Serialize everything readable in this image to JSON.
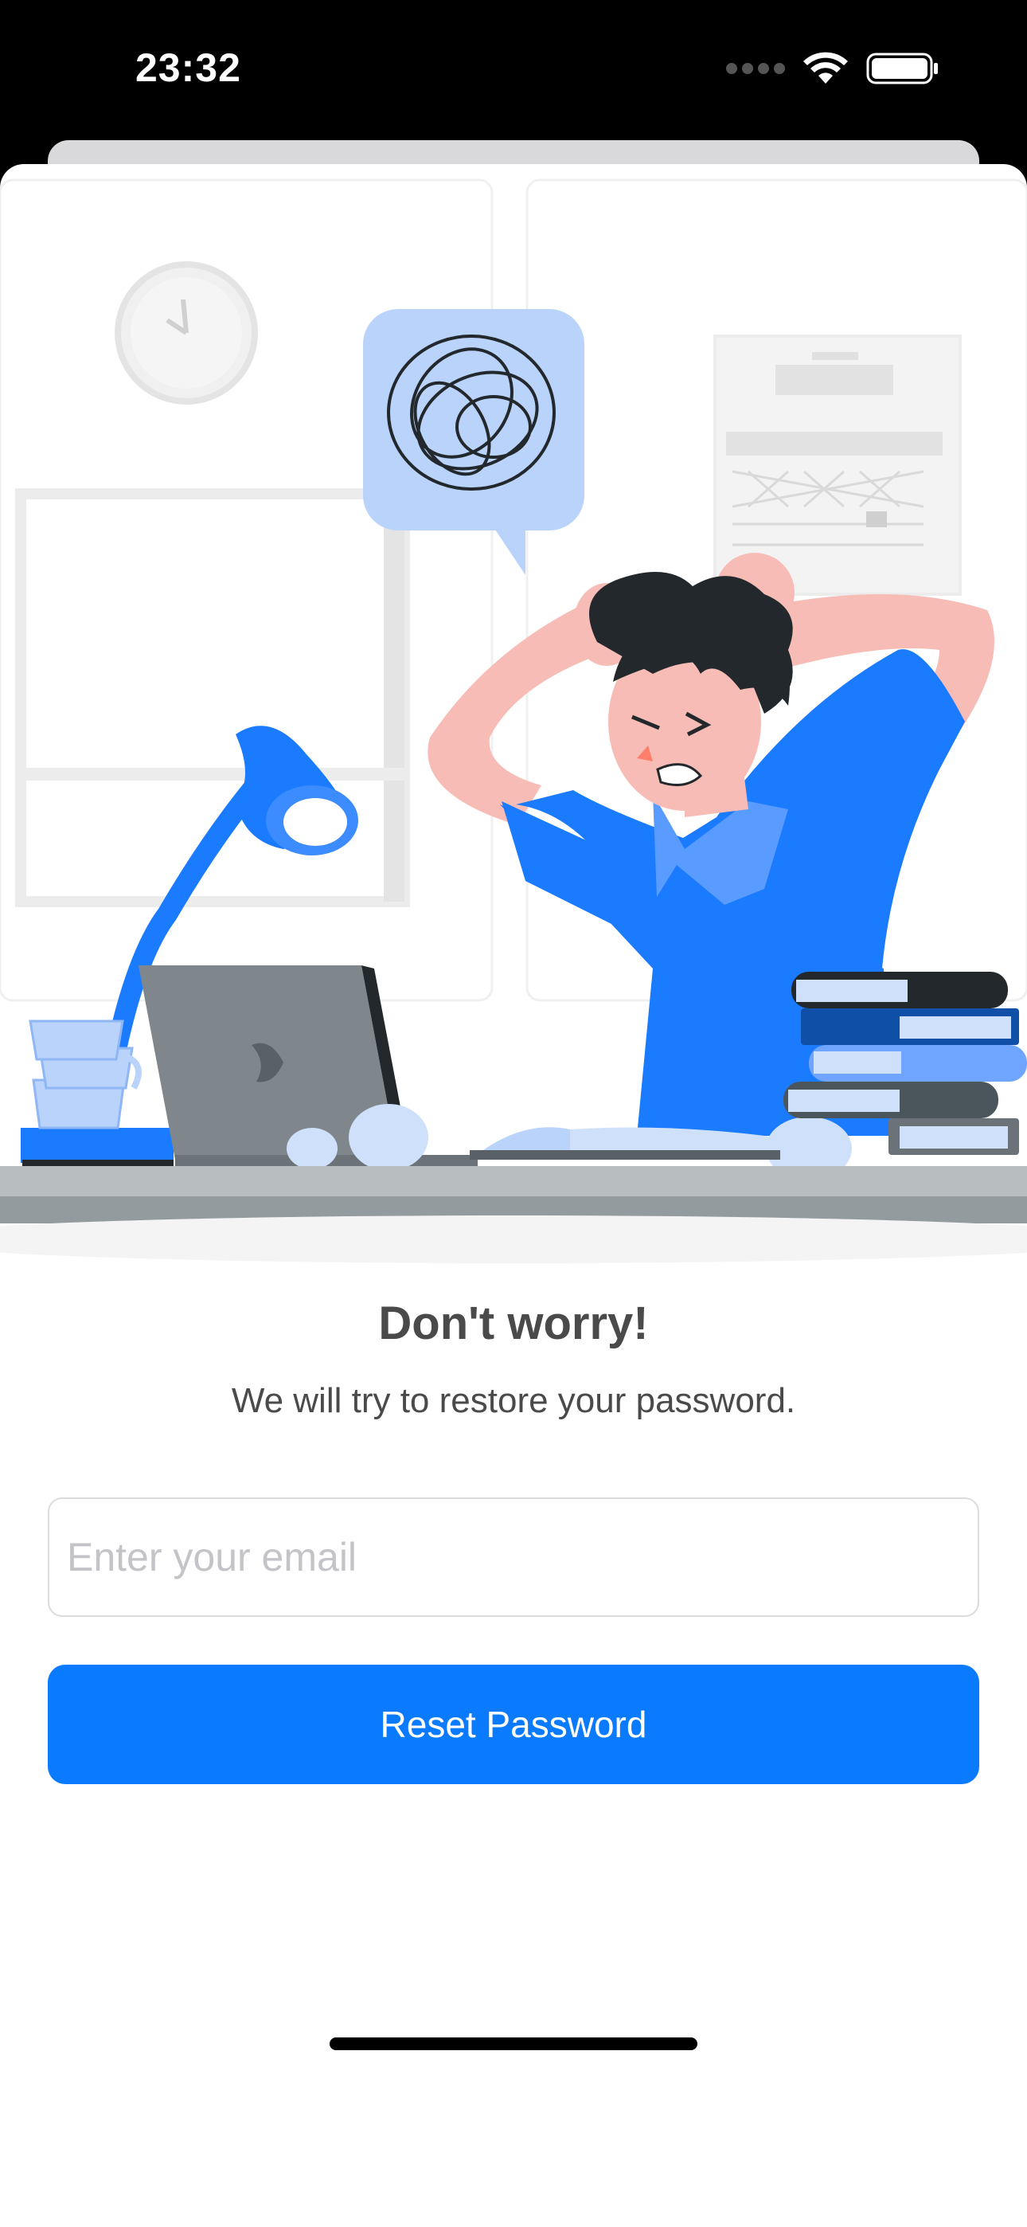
{
  "status_bar": {
    "time": "23:32",
    "icons": [
      "cellular-signal-icon",
      "wifi-icon",
      "battery-icon"
    ]
  },
  "illustration": {
    "icon": "frustrated-man-at-desk-illustration",
    "accent_color": "#1a7bff"
  },
  "content": {
    "title": "Don't worry!",
    "subtitle": "We will try to restore your password."
  },
  "form": {
    "email_placeholder": "Enter your email",
    "email_value": "",
    "reset_button_label": "Reset Password"
  },
  "colors": {
    "primary": "#0a7aff",
    "text": "#4a4a4a",
    "placeholder": "#c4c4c8"
  }
}
